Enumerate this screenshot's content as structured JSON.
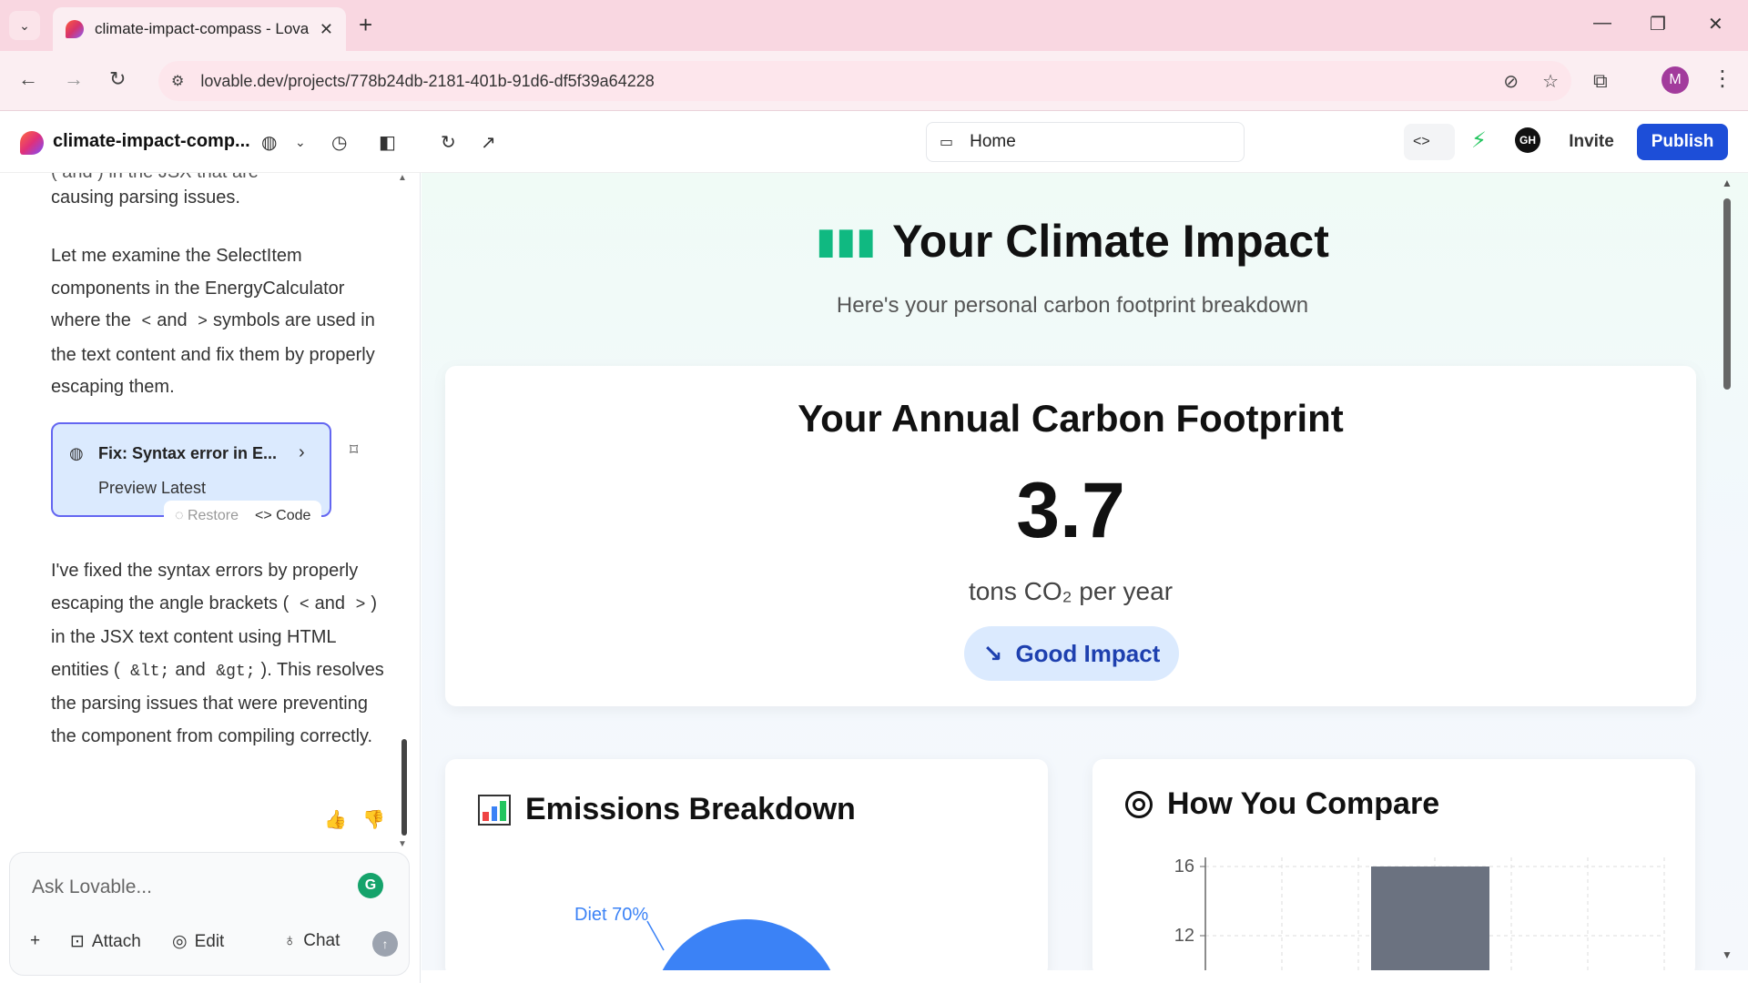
{
  "browser": {
    "tab_title": "climate-impact-compass - Lova",
    "url": "lovable.dev/projects/778b24db-2181-401b-91d6-df5f39a64228",
    "profile_initial": "M"
  },
  "toolbar": {
    "project_name": "climate-impact-comp...",
    "route": "Home",
    "invite_label": "Invite",
    "publish_label": "Publish"
  },
  "chat": {
    "clipped_line": "(  and  ) in the JSX that are",
    "message_1": "causing parsing issues.",
    "message_2_parts": {
      "a": "Let me examine the SelectItem components in the EnergyCalculator where the",
      "lt": "<",
      "and": "and",
      "gt": ">",
      "b": "symbols are used in the text content and fix them by properly escaping them."
    },
    "version_card": {
      "title": "Fix: Syntax error in E...",
      "subtitle": "Preview Latest",
      "restore_label": "Restore",
      "code_label": "Code"
    },
    "message_3_parts": {
      "a": "I've fixed the syntax errors by properly escaping the angle brackets (",
      "lt": "<",
      "and1": "and",
      "gt": ">",
      "b": ") in the JSX text content using HTML entities (",
      "lt_entity": "&lt;",
      "and2": "and",
      "gt_entity": "&gt;",
      "c": "). This resolves the parsing issues that were preventing the component from compiling correctly."
    },
    "input_placeholder": "Ask Lovable...",
    "actions": {
      "attach": "Attach",
      "edit": "Edit",
      "chat": "Chat"
    }
  },
  "preview": {
    "hero_title": "Your Climate Impact",
    "hero_subtitle": "Here's your personal carbon footprint breakdown",
    "footprint_card": {
      "title": "Your Annual Carbon Footprint",
      "value": "3.7",
      "units": "tons CO₂ per year",
      "badge": "Good Impact"
    },
    "emissions_card": {
      "title": "Emissions Breakdown",
      "pie_label": "Diet 70%"
    },
    "compare_card": {
      "title": "How You Compare",
      "yticks": [
        "16",
        "12"
      ]
    }
  },
  "colors": {
    "accent_blue": "#1d4ed8",
    "pie_blue": "#3b82f6",
    "compare_bar": "#6b7280",
    "brand_green": "#10b981"
  },
  "chart_data": [
    {
      "type": "pie",
      "title": "Emissions Breakdown",
      "slices": [
        {
          "label": "Diet",
          "value": 70
        }
      ]
    },
    {
      "type": "bar",
      "title": "How You Compare",
      "yticks": [
        12,
        16
      ],
      "series": [
        {
          "values": [
            16
          ]
        }
      ]
    }
  ]
}
